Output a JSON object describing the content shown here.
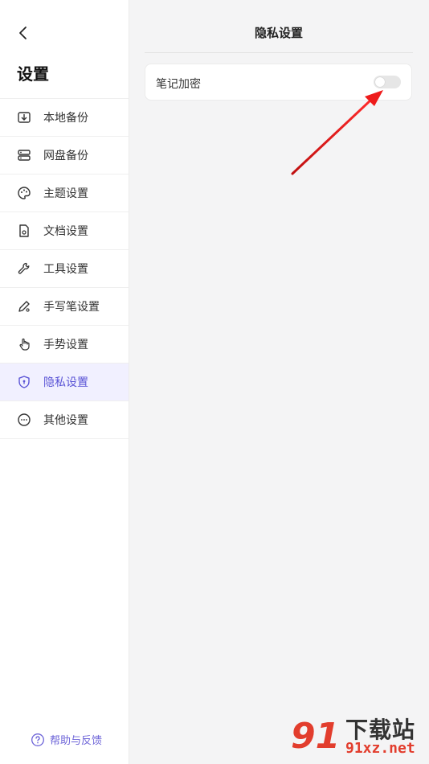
{
  "sidebar": {
    "title": "设置",
    "items": [
      {
        "label": "本地备份",
        "icon": "local-backup-icon",
        "active": false
      },
      {
        "label": "网盘备份",
        "icon": "cloud-backup-icon",
        "active": false
      },
      {
        "label": "主题设置",
        "icon": "palette-icon",
        "active": false
      },
      {
        "label": "文档设置",
        "icon": "document-settings-icon",
        "active": false
      },
      {
        "label": "工具设置",
        "icon": "wrench-icon",
        "active": false
      },
      {
        "label": "手写笔设置",
        "icon": "pen-icon",
        "active": false
      },
      {
        "label": "手势设置",
        "icon": "hand-gesture-icon",
        "active": false
      },
      {
        "label": "隐私设置",
        "icon": "shield-icon",
        "active": true
      },
      {
        "label": "其他设置",
        "icon": "more-icon",
        "active": false
      }
    ],
    "help_label": "帮助与反馈"
  },
  "main": {
    "title": "隐私设置",
    "settings": [
      {
        "label": "笔记加密",
        "enabled": false
      }
    ]
  },
  "watermark": {
    "cn": "下载站",
    "en": "91xz.net",
    "logo": "91"
  },
  "colors": {
    "accent": "#5b55d6",
    "active_bg": "#f1f0ff",
    "arrow": "#e02020"
  }
}
